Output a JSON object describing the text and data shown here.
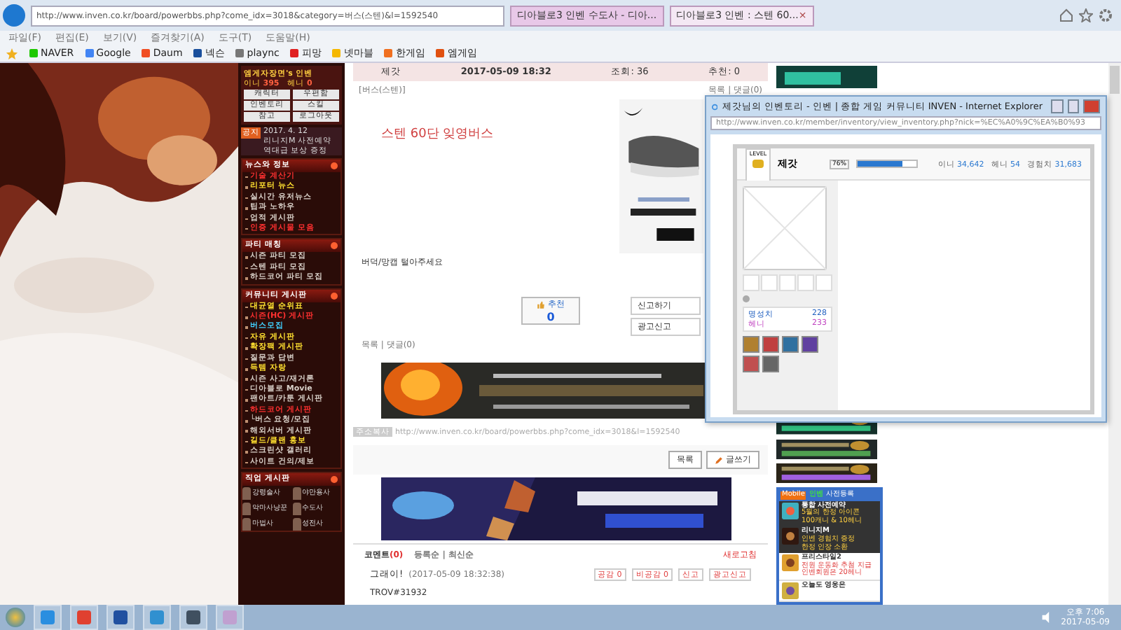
{
  "browser": {
    "url": "http://www.inven.co.kr/board/powerbbs.php?come_idx=3018&category=버스(스텐)&l=1592540",
    "tabs": [
      {
        "label": "디아블로3 인벤 수도사 - 디아...",
        "selected": false
      },
      {
        "label": "디아블로3 인벤 : 스텐 60...",
        "selected": true
      }
    ],
    "close_tab": "×",
    "menu": [
      "파일(F)",
      "편집(E)",
      "보기(V)",
      "즐겨찾기(A)",
      "도구(T)",
      "도움말(H)"
    ],
    "favorites": [
      {
        "label": "NAVER",
        "color": "#1ec800"
      },
      {
        "label": "Google",
        "color": "#4285f4"
      },
      {
        "label": "Daum",
        "color": "#f04e23"
      },
      {
        "label": "넥슨",
        "color": "#1a4f9c"
      },
      {
        "label": "plaync",
        "color": "#777777"
      },
      {
        "label": "피망",
        "color": "#e02020"
      },
      {
        "label": "넷마블",
        "color": "#f5b800"
      },
      {
        "label": "한게임",
        "color": "#f07020"
      },
      {
        "label": "엠게임",
        "color": "#e05010"
      }
    ]
  },
  "sidebar": {
    "user": "엠게자장면's 인벤",
    "ini": "이니",
    "ini_value": "395",
    "heni": "헤니",
    "heni_value": "0",
    "buttons": [
      "캐릭터",
      "우편함",
      "인벤토리",
      "스킬",
      "참고",
      "로그아웃"
    ],
    "notice": {
      "badge": "공지",
      "date": "2017. 4. 12",
      "lines": [
        "리니지M 사전예약",
        "역대급 보상 증정"
      ]
    },
    "sections": [
      {
        "title": "뉴스와 정보",
        "items": [
          {
            "label": "기술 계산기",
            "kind": "hot"
          },
          {
            "label": "리포터 뉴스",
            "kind": "featured"
          },
          {
            "label": "실시간 유저뉴스",
            "kind": "plain"
          },
          {
            "label": "팁과 노하우",
            "kind": "plain"
          },
          {
            "label": "업적 게시판",
            "kind": "plain"
          },
          {
            "label": "인증 게시물 모음",
            "kind": "hot"
          }
        ]
      },
      {
        "title": "파티 매칭",
        "items": [
          {
            "label": "시즌 파티 모집",
            "kind": "plain"
          },
          {
            "label": "스텐 파티 모집",
            "kind": "plain"
          },
          {
            "label": "하드코어 파티 모집",
            "kind": "plain"
          }
        ]
      },
      {
        "title": "커뮤니티 게시판",
        "items": [
          {
            "label": "대균열 순위표",
            "kind": "featured"
          },
          {
            "label": "시즌(HC) 게시판",
            "kind": "hot"
          },
          {
            "label": "버스모집",
            "kind": "current"
          },
          {
            "label": "자유 게시판",
            "kind": "featured"
          },
          {
            "label": "확장팩 게시판",
            "kind": "featured"
          },
          {
            "label": "질문과 답변",
            "kind": "plain"
          },
          {
            "label": "득템 자랑",
            "kind": "featured"
          },
          {
            "label": "시즌 사고/재거론",
            "kind": "plain"
          },
          {
            "label": "디아블로 Movie",
            "kind": "plain"
          },
          {
            "label": "팬아트/카툰 게시판",
            "kind": "plain"
          },
          {
            "label": "하드코어 게시판",
            "kind": "hot"
          },
          {
            "label": "└버스 요청/모집",
            "kind": "plain"
          },
          {
            "label": "해외서버 게시판",
            "kind": "plain"
          },
          {
            "label": "길드/클랜 홍보",
            "kind": "featured"
          },
          {
            "label": "스크린샷 갤러리",
            "kind": "plain"
          },
          {
            "label": "사이트 건의/제보",
            "kind": "plain"
          }
        ]
      }
    ],
    "classes_title": "직업 게시판",
    "classes": [
      "강령술사",
      "야만용사",
      "악마사냥꾼",
      "수도사",
      "마법사",
      "성전사"
    ]
  },
  "post": {
    "author": "제갓",
    "date": "2017-05-09 18:32",
    "views": "조회: 36",
    "recommends": "추천: 0",
    "category": "[버스(스텐)]",
    "list_top": "목록 | 댓글(0)",
    "title": "스텐 60단 잊영버스",
    "body": "버덕/망캡 털아주세요",
    "recommend": {
      "label": "추천",
      "count": "0"
    },
    "report": "신고하기",
    "ad_report": "광고신고",
    "list_bottom": "목록 | 댓글(0)",
    "copy_label": "주소복사",
    "link": "http://www.inven.co.kr/board/powerbbs.php?come_idx=3018&l=1592540",
    "list_button": "목록",
    "write_button": "글쓰기"
  },
  "comments": {
    "title": "코멘트",
    "count": "(0)",
    "sort": "등록순 | 최신순",
    "refresh": "새로고침",
    "items": [
      {
        "author": "그래이!",
        "date": "(2017-05-09 18:32:38)",
        "buttons": [
          "공감 0",
          "비공감 0",
          "신고",
          "광고신고"
        ],
        "text": "TROV#31932"
      }
    ]
  },
  "right_panel": {
    "title": "사전등록",
    "brand": "인벤",
    "badge": "Mobile",
    "items": [
      {
        "title": "통합 사전예약",
        "lines": [
          "5월의 한정 아이콘",
          "100캐니 & 10헤니"
        ],
        "kind": "dark"
      },
      {
        "title": "리니지M",
        "lines": [
          "인벤 경험치 증정",
          "한정 인장 소환"
        ],
        "kind": "dark"
      },
      {
        "title": "프리스타일2",
        "lines": [
          "전원 운동화 추첨 지급",
          "인벤회원은 20헤니"
        ],
        "kind": "light"
      },
      {
        "title": "오늘도 영웅은",
        "kind": "light"
      }
    ]
  },
  "popup": {
    "title": "제갓님의 인벤토리 - 인벤 | 종합 게임 커뮤니티 INVEN - Internet Explorer",
    "url": "http://www.inven.co.kr/member/inventory/view_inventory.php?nick=%EC%A0%9C%EA%B0%93",
    "level_label": "LEVEL",
    "name": "제갓",
    "percent": "76%",
    "level": 0.76,
    "stats": [
      {
        "label": "이니",
        "value": "34,642"
      },
      {
        "label": "헤니",
        "value": "54"
      },
      {
        "label": "경험치",
        "value": "31,683"
      }
    ],
    "points": [
      {
        "label": "명성치",
        "value": "228",
        "kind": "fame"
      },
      {
        "label": "헤니",
        "value": "233",
        "kind": "heni"
      }
    ]
  },
  "taskbar": {
    "time": "오후 7:06",
    "date": "2017-05-09"
  }
}
